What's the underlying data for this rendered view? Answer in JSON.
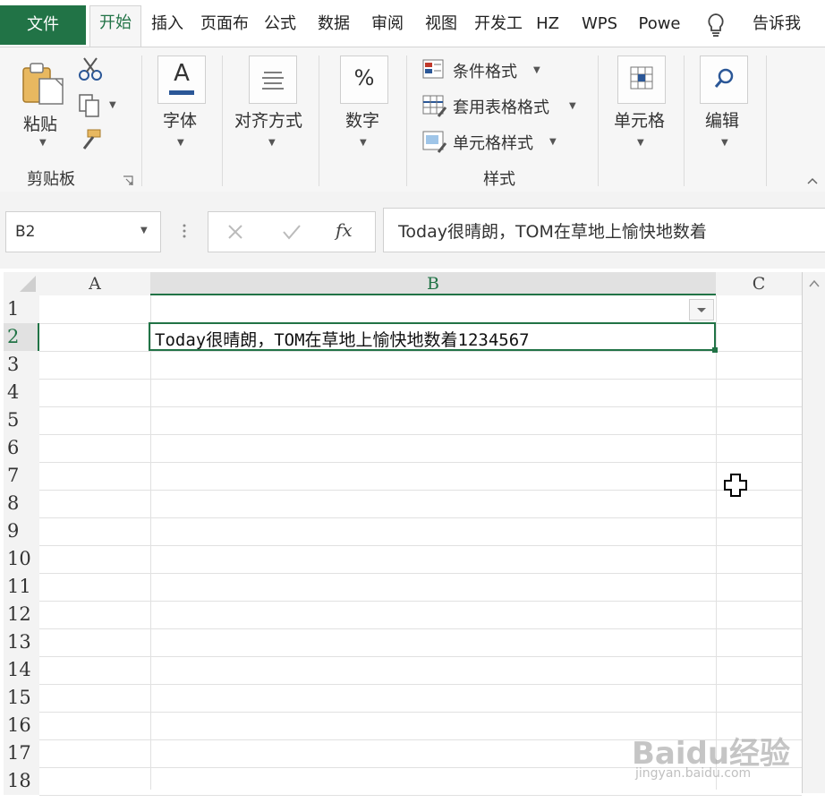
{
  "tabs": {
    "file": "文件",
    "home": "开始",
    "insert": "插入",
    "page_layout": "页面布",
    "formulas": "公式",
    "data": "数据",
    "review": "审阅",
    "view": "视图",
    "developer": "开发工",
    "hz": "HZ",
    "wps": "WPS",
    "power": "Powe",
    "tell_me": "告诉我"
  },
  "ribbon": {
    "clipboard": {
      "paste": "粘贴",
      "group_label": "剪贴板"
    },
    "font": {
      "label": "字体",
      "icon_letter": "A"
    },
    "alignment": {
      "label": "对齐方式"
    },
    "number": {
      "label": "数字",
      "icon_symbol": "%"
    },
    "styles": {
      "conditional_format": "条件格式",
      "format_as_table": "套用表格格式",
      "cell_styles": "单元格样式",
      "group_label": "样式"
    },
    "cells": {
      "label": "单元格"
    },
    "editing": {
      "label": "编辑"
    }
  },
  "formula_bar": {
    "name_box": "B2",
    "fx": "fx",
    "content": "Today很晴朗，TOM在草地上愉快地数着"
  },
  "sheet": {
    "columns": [
      "A",
      "B",
      "C"
    ],
    "rows": [
      "1",
      "2",
      "3",
      "4",
      "5",
      "6",
      "7",
      "8",
      "9",
      "10",
      "11",
      "12",
      "13",
      "14",
      "15",
      "16",
      "17",
      "18"
    ],
    "selected_cell": "B2",
    "cell_B2": "Today很晴朗，TOM在草地上愉快地数着1234567"
  },
  "watermark": {
    "brand": "Baidu经验",
    "url": "jingyan.baidu.com"
  },
  "colors": {
    "accent": "#217346",
    "selection": "#217346"
  }
}
